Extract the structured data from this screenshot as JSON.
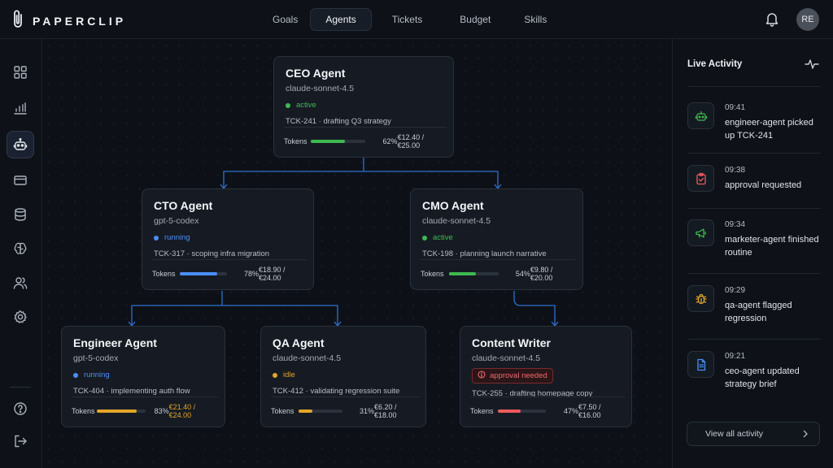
{
  "app": {
    "brand": "PAPERCLIP"
  },
  "nav": [
    "Goals",
    "Agents",
    "Tickets",
    "Budget",
    "Skills"
  ],
  "user": {
    "initials": "RE"
  },
  "sidebar": {
    "icons": [
      "dashboard-icon",
      "analytics-icon",
      "agents-icon",
      "billing-icon",
      "database-icon",
      "brain-icon",
      "team-icon",
      "settings-icon",
      "help-icon",
      "logout-icon"
    ],
    "active": "agents-icon"
  },
  "agents": {
    "ceo": {
      "name": "CEO Agent",
      "model": "claude-sonnet-4.5",
      "status": "active",
      "ticket": "TCK-241",
      "task": "drafting Q3 strategy",
      "tokens_label": "Tokens",
      "pct_value": 62,
      "pct": "62%",
      "cost": "€12.40 / €25.00"
    },
    "cto": {
      "name": "CTO Agent",
      "model": "gpt-5-codex",
      "status": "running",
      "ticket": "TCK-317",
      "task": "scoping infra migration",
      "tokens_label": "Tokens",
      "pct_value": 78,
      "pct": "78%",
      "cost": "€18.90 / €24.00"
    },
    "cmo": {
      "name": "CMO Agent",
      "model": "claude-sonnet-4.5",
      "status": "active",
      "ticket": "TCK-198",
      "task": "planning launch narrative",
      "tokens_label": "Tokens",
      "pct_value": 54,
      "pct": "54%",
      "cost": "€9.80 / €20.00"
    },
    "engineer": {
      "name": "Engineer Agent",
      "model": "gpt-5-codex",
      "status": "running",
      "ticket": "TCK-404",
      "task": "implementing auth flow",
      "tokens_label": "Tokens",
      "pct_value": 83,
      "pct": "83%",
      "cost": "€21.40 / €24.00"
    },
    "qa": {
      "name": "QA Agent",
      "model": "claude-sonnet-4.5",
      "status": "idle",
      "ticket": "TCK-412",
      "task": "validating regression suite",
      "tokens_label": "Tokens",
      "pct_value": 31,
      "pct": "31%",
      "cost": "€6.20 / €18.00"
    },
    "writer": {
      "name": "Content Writer",
      "model": "claude-sonnet-4.5",
      "status": "approval needed",
      "ticket": "TCK-255",
      "task": "drafting homepage copy",
      "tokens_label": "Tokens",
      "pct_value": 47,
      "pct": "47%",
      "cost": "€7.50 / €16.00"
    }
  },
  "colors": {
    "active": "#3fb950",
    "running": "#4c8ef7",
    "idle": "#e3a52a",
    "danger": "#ef5b5b",
    "wire": "#2f6fd0"
  },
  "activity": {
    "title": "Live Activity",
    "items": [
      {
        "time": "09:41",
        "text": "engineer-agent picked up TCK-241",
        "icon": "robot-icon"
      },
      {
        "time": "09:38",
        "text": "approval requested",
        "icon": "clipboard-check-icon"
      },
      {
        "time": "09:34",
        "text": "marketer-agent finished routine",
        "icon": "megaphone-icon"
      },
      {
        "time": "09:29",
        "text": "qa-agent flagged regression",
        "icon": "bug-icon"
      },
      {
        "time": "09:21",
        "text": "ceo-agent updated strategy brief",
        "icon": "document-icon"
      }
    ],
    "view_all": "View all activity"
  }
}
